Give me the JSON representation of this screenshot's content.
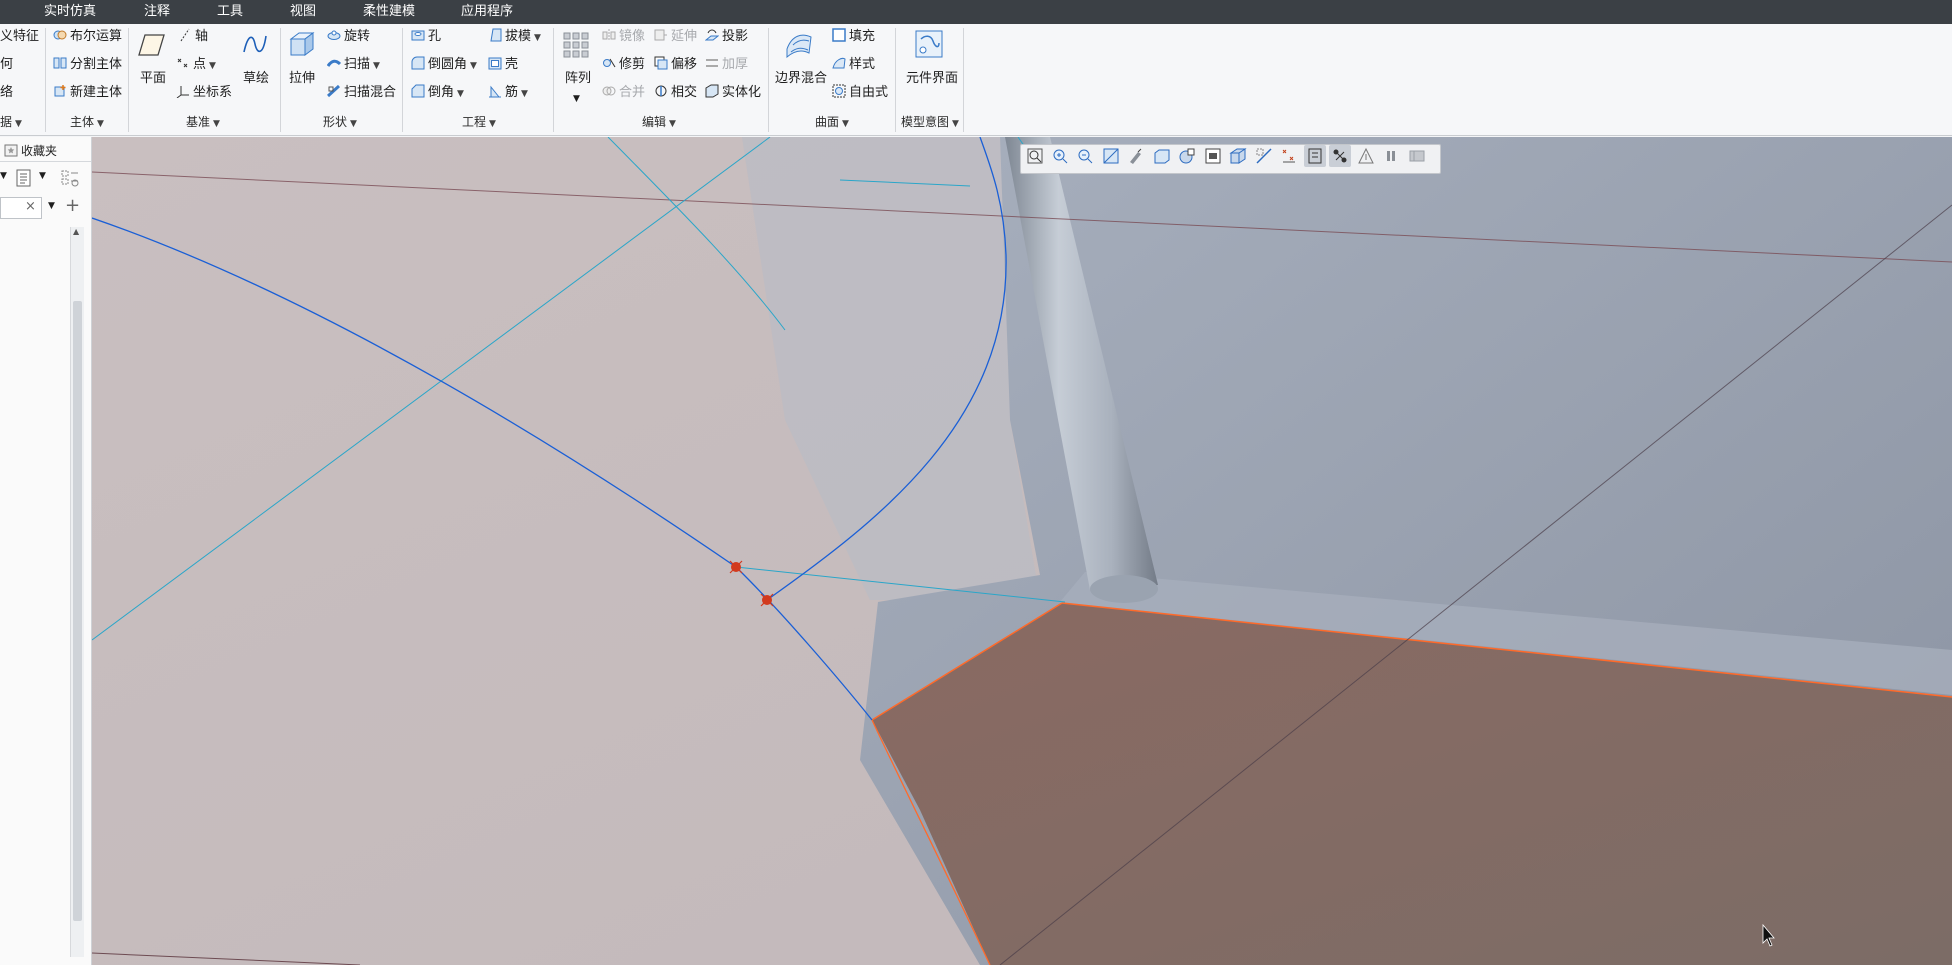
{
  "menubar": {
    "items": [
      "实时仿真",
      "注释",
      "工具",
      "视图",
      "柔性建模",
      "应用程序"
    ]
  },
  "ribbon": {
    "partial_left": {
      "item1": "义特征",
      "item2": "何",
      "item3": "络",
      "group": "据"
    },
    "body_group": {
      "label": "主体",
      "items": [
        "布尔运算",
        "分割主体",
        "新建主体"
      ]
    },
    "datum_group": {
      "label": "基准",
      "plane": "平面",
      "axis": "轴",
      "point": "点",
      "csys": "坐标系",
      "sketch": "草绘"
    },
    "shape_group": {
      "label": "形状",
      "extrude": "拉伸",
      "revolve": "旋转",
      "sweep": "扫描",
      "swept_blend": "扫描混合"
    },
    "engineering_group": {
      "label": "工程",
      "hole": "孔",
      "round": "倒圆角",
      "chamfer": "倒角",
      "draft": "拔模",
      "shell": "壳",
      "rib": "筋"
    },
    "editing_group": {
      "label": "编辑",
      "pattern": "阵列",
      "mirror": "镜像",
      "extend": "延伸",
      "project": "投影",
      "trim": "修剪",
      "offset": "偏移",
      "thicken": "加厚",
      "merge": "合并",
      "intersect": "相交",
      "solidify": "实体化"
    },
    "surfaces_group": {
      "label": "曲面",
      "boundary_blend": "边界混合",
      "fill": "填充",
      "style": "样式",
      "freestyle": "自由式"
    },
    "model_intent_group": {
      "label": "模型意图",
      "component_interface": "元件界面"
    }
  },
  "left_panel": {
    "favorites_tab": "收藏夹",
    "search_value": ""
  },
  "graphics_toolbar": {
    "buttons": [
      "refit-icon",
      "zoom-in-icon",
      "zoom-out-icon",
      "repaint-icon",
      "pan-icon",
      "display-style-icon",
      "saved-orientations-icon",
      "view-manager-icon",
      "perspective-icon",
      "datum-display-icon",
      "annotation-display-icon",
      "spin-center-icon",
      "point-display-icon",
      "csys-display-icon",
      "section-icon",
      "pause-icon",
      "appearance-icon"
    ]
  },
  "colors": {
    "menubar": "#3b4045",
    "sketch_curve": "#1a5fd6",
    "datum_curve": "#2aa6c9",
    "selected_surface": "#80675f",
    "selected_edge": "#ff6a2a",
    "datum_point": "#d23a1e"
  }
}
